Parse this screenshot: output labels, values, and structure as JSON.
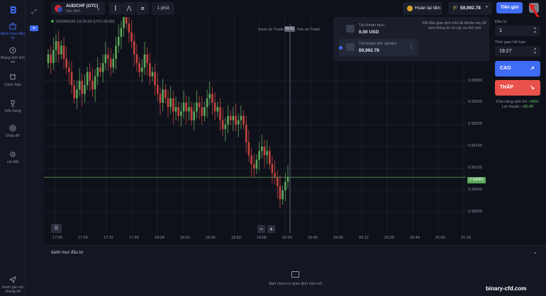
{
  "sidebar": {
    "items": [
      {
        "label": "danh mục đầu tư",
        "icon": "briefcase-icon"
      },
      {
        "label": "Mạng tính lịch sử",
        "icon": "history-icon"
      },
      {
        "label": "Cảnh báo",
        "icon": "alarm-icon"
      },
      {
        "label": "Xếp hạng",
        "icon": "trophy-icon"
      },
      {
        "label": "Giúp đỡ",
        "icon": "help-icon"
      },
      {
        "label": "cài đặt",
        "icon": "gear-icon"
      },
      {
        "label": "tham gia với chúng tôi",
        "icon": "send-icon"
      }
    ]
  },
  "topbar": {
    "asset_name": "AUD/CHF (OTC)",
    "asset_sub": "Hạn định",
    "timeframe": "1 phút",
    "refund_label": "Hoàn lại tiền",
    "balance": "$9,992.78",
    "deposit_label": "Tiền gửi"
  },
  "account_dropdown": {
    "real_label": "Tài khoản thực",
    "real_value": "0,00 USD",
    "demo_label": "Tài khoản thử nghiệm",
    "demo_value": "$9,992.78",
    "note": "Bắt đầu giao dịch trên tài khoản này để xem thông tin về các ưu thế mới"
  },
  "chart_header": {
    "datetime": "20/04/2024  19:25:59 (UTC-03:00)",
    "trade_start": "Inicio do Trade",
    "trade_tag": "01:01",
    "trade_end": "Fim do Trade"
  },
  "right_panel": {
    "invest_label": "Đầu tư",
    "invest_value": "1",
    "time_label": "Thời gian hết hạn",
    "time_value": "19:27",
    "up_label": "CAO",
    "down_label": "THẤP",
    "payout_label": "Khả năng sinh lời:",
    "payout_value": "+88%",
    "profit_label": "Lợi nhuận:",
    "profit_value": "+$0.88"
  },
  "portfolio": {
    "title": "danh mục đầu tư",
    "empty_message": "Bạn chưa có giao dịch nào mở"
  },
  "watermark": "binary-cfd.com",
  "colors": {
    "accent": "#3f6bf5",
    "up": "#5da85b",
    "down": "#e8524a",
    "bg": "#0f111a"
  },
  "chart_data": {
    "type": "candlestick",
    "current_price": "0.58081",
    "y_ticks": [
      "0.58300",
      "0.58250",
      "0.58200",
      "0.58150",
      "0.58100",
      "0.58050",
      "0.58000"
    ],
    "x_ticks": [
      "17:00",
      "17:16",
      "17:32",
      "17:48",
      "18:04",
      "18:20",
      "18:36",
      "18:52",
      "19:08",
      "19:24",
      "19:40",
      "19:56",
      "20:12",
      "20:28",
      "20:44",
      "21:00",
      "21:16"
    ],
    "close": [
      0.5836,
      0.5834,
      0.5837,
      0.5839,
      0.5836,
      0.5838,
      0.5835,
      0.5833,
      0.5832,
      0.5829,
      0.5826,
      0.5828,
      0.583,
      0.5827,
      0.5829,
      0.5832,
      0.583,
      0.5828,
      0.5831,
      0.5833,
      0.5832,
      0.5834,
      0.5836,
      0.5835,
      0.5833,
      0.5835,
      0.5838,
      0.584,
      0.5842,
      0.5845,
      0.5843,
      0.5841,
      0.5839,
      0.5836,
      0.5834,
      0.5832,
      0.5833,
      0.5836,
      0.5834,
      0.5831,
      0.5832,
      0.5829,
      0.5827,
      0.5825,
      0.5828,
      0.5826,
      0.5824,
      0.5826,
      0.5823,
      0.5824,
      0.5822,
      0.5823,
      0.5825,
      0.5823,
      0.5824,
      0.5821,
      0.5823,
      0.5825,
      0.5824,
      0.5822,
      0.5824,
      0.5826,
      0.5827,
      0.5825,
      0.5823,
      0.5824,
      0.5821,
      0.5819,
      0.582,
      0.5822,
      0.5821,
      0.5822,
      0.582,
      0.5821,
      0.5822,
      0.582,
      0.5816,
      0.5813,
      0.5811,
      0.581,
      0.5812,
      0.5814,
      0.5815,
      0.5813,
      0.5814,
      0.5811,
      0.5809,
      0.5808,
      0.5806,
      0.5803,
      0.5805,
      0.5807,
      0.5808
    ]
  }
}
